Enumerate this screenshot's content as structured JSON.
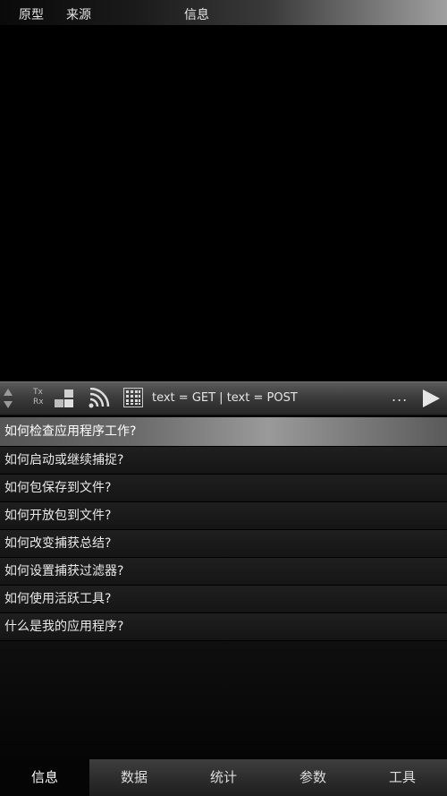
{
  "columns": {
    "col1": "原型",
    "col2": "来源",
    "col3": "信息"
  },
  "toolbar": {
    "tx_label": "Tx",
    "rx_label": "Rx",
    "filter_text": "text = GET | text = POST",
    "more_label": "..."
  },
  "icons": {
    "updown": "up-down-arrows-icon",
    "txrx": "tx-rx-icon",
    "blocks": "blocks-icon",
    "wifi": "wifi-icon",
    "grid": "grid-icon",
    "play": "play-icon"
  },
  "help": {
    "items": [
      "如何检查应用程序工作?",
      "如何启动或继续捕捉?",
      "如何包保存到文件?",
      "如何开放包到文件?",
      "如何改变捕获总结?",
      "如何设置捕获过滤器?",
      "如何使用活跃工具?",
      "什么是我的应用程序?"
    ],
    "selected_index": 0
  },
  "tabs": [
    "信息",
    "数据",
    "统计",
    "参数",
    "工具"
  ],
  "active_tab": 0
}
